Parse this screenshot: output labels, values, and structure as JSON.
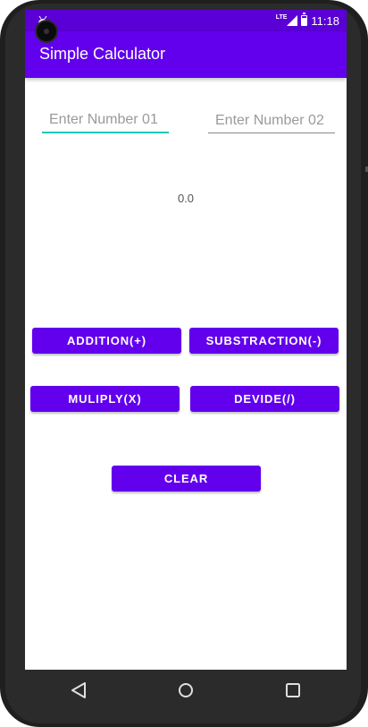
{
  "status_bar": {
    "notification_icon": "android-icon",
    "network_label": "LTE",
    "time": "11:18"
  },
  "app_bar": {
    "title": "Simple Calculator"
  },
  "inputs": {
    "number1_placeholder": "Enter Number 01",
    "number1_value": "",
    "number2_placeholder": "Enter Number 02",
    "number2_value": ""
  },
  "result": "0.0",
  "buttons": {
    "addition": "ADDITION(+)",
    "substraction": "SUBSTRACTION(-)",
    "multiply": "MULIPLY(X)",
    "devide": "DEVIDE(/)",
    "clear": "CLEAR"
  },
  "nav_bar": {
    "back_icon": "back-triangle-icon",
    "home_icon": "home-circle-icon",
    "recents_icon": "recents-square-icon"
  },
  "colors": {
    "status_bar": "#5a00d6",
    "primary": "#6200ee",
    "field_accent": "#1fc7b8"
  }
}
